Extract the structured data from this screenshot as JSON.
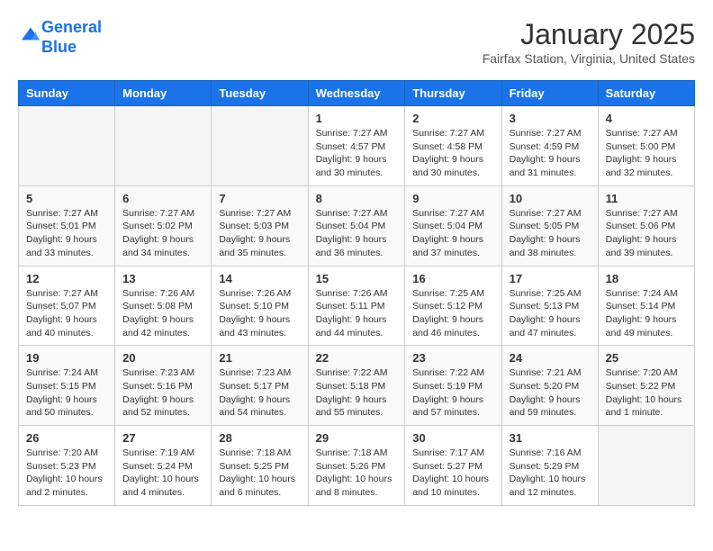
{
  "header": {
    "logo_line1": "General",
    "logo_line2": "Blue",
    "month": "January 2025",
    "location": "Fairfax Station, Virginia, United States"
  },
  "weekdays": [
    "Sunday",
    "Monday",
    "Tuesday",
    "Wednesday",
    "Thursday",
    "Friday",
    "Saturday"
  ],
  "weeks": [
    [
      {
        "day": "",
        "info": ""
      },
      {
        "day": "",
        "info": ""
      },
      {
        "day": "",
        "info": ""
      },
      {
        "day": "1",
        "info": "Sunrise: 7:27 AM\nSunset: 4:57 PM\nDaylight: 9 hours\nand 30 minutes."
      },
      {
        "day": "2",
        "info": "Sunrise: 7:27 AM\nSunset: 4:58 PM\nDaylight: 9 hours\nand 30 minutes."
      },
      {
        "day": "3",
        "info": "Sunrise: 7:27 AM\nSunset: 4:59 PM\nDaylight: 9 hours\nand 31 minutes."
      },
      {
        "day": "4",
        "info": "Sunrise: 7:27 AM\nSunset: 5:00 PM\nDaylight: 9 hours\nand 32 minutes."
      }
    ],
    [
      {
        "day": "5",
        "info": "Sunrise: 7:27 AM\nSunset: 5:01 PM\nDaylight: 9 hours\nand 33 minutes."
      },
      {
        "day": "6",
        "info": "Sunrise: 7:27 AM\nSunset: 5:02 PM\nDaylight: 9 hours\nand 34 minutes."
      },
      {
        "day": "7",
        "info": "Sunrise: 7:27 AM\nSunset: 5:03 PM\nDaylight: 9 hours\nand 35 minutes."
      },
      {
        "day": "8",
        "info": "Sunrise: 7:27 AM\nSunset: 5:04 PM\nDaylight: 9 hours\nand 36 minutes."
      },
      {
        "day": "9",
        "info": "Sunrise: 7:27 AM\nSunset: 5:04 PM\nDaylight: 9 hours\nand 37 minutes."
      },
      {
        "day": "10",
        "info": "Sunrise: 7:27 AM\nSunset: 5:05 PM\nDaylight: 9 hours\nand 38 minutes."
      },
      {
        "day": "11",
        "info": "Sunrise: 7:27 AM\nSunset: 5:06 PM\nDaylight: 9 hours\nand 39 minutes."
      }
    ],
    [
      {
        "day": "12",
        "info": "Sunrise: 7:27 AM\nSunset: 5:07 PM\nDaylight: 9 hours\nand 40 minutes."
      },
      {
        "day": "13",
        "info": "Sunrise: 7:26 AM\nSunset: 5:08 PM\nDaylight: 9 hours\nand 42 minutes."
      },
      {
        "day": "14",
        "info": "Sunrise: 7:26 AM\nSunset: 5:10 PM\nDaylight: 9 hours\nand 43 minutes."
      },
      {
        "day": "15",
        "info": "Sunrise: 7:26 AM\nSunset: 5:11 PM\nDaylight: 9 hours\nand 44 minutes."
      },
      {
        "day": "16",
        "info": "Sunrise: 7:25 AM\nSunset: 5:12 PM\nDaylight: 9 hours\nand 46 minutes."
      },
      {
        "day": "17",
        "info": "Sunrise: 7:25 AM\nSunset: 5:13 PM\nDaylight: 9 hours\nand 47 minutes."
      },
      {
        "day": "18",
        "info": "Sunrise: 7:24 AM\nSunset: 5:14 PM\nDaylight: 9 hours\nand 49 minutes."
      }
    ],
    [
      {
        "day": "19",
        "info": "Sunrise: 7:24 AM\nSunset: 5:15 PM\nDaylight: 9 hours\nand 50 minutes."
      },
      {
        "day": "20",
        "info": "Sunrise: 7:23 AM\nSunset: 5:16 PM\nDaylight: 9 hours\nand 52 minutes."
      },
      {
        "day": "21",
        "info": "Sunrise: 7:23 AM\nSunset: 5:17 PM\nDaylight: 9 hours\nand 54 minutes."
      },
      {
        "day": "22",
        "info": "Sunrise: 7:22 AM\nSunset: 5:18 PM\nDaylight: 9 hours\nand 55 minutes."
      },
      {
        "day": "23",
        "info": "Sunrise: 7:22 AM\nSunset: 5:19 PM\nDaylight: 9 hours\nand 57 minutes."
      },
      {
        "day": "24",
        "info": "Sunrise: 7:21 AM\nSunset: 5:20 PM\nDaylight: 9 hours\nand 59 minutes."
      },
      {
        "day": "25",
        "info": "Sunrise: 7:20 AM\nSunset: 5:22 PM\nDaylight: 10 hours\nand 1 minute."
      }
    ],
    [
      {
        "day": "26",
        "info": "Sunrise: 7:20 AM\nSunset: 5:23 PM\nDaylight: 10 hours\nand 2 minutes."
      },
      {
        "day": "27",
        "info": "Sunrise: 7:19 AM\nSunset: 5:24 PM\nDaylight: 10 hours\nand 4 minutes."
      },
      {
        "day": "28",
        "info": "Sunrise: 7:18 AM\nSunset: 5:25 PM\nDaylight: 10 hours\nand 6 minutes."
      },
      {
        "day": "29",
        "info": "Sunrise: 7:18 AM\nSunset: 5:26 PM\nDaylight: 10 hours\nand 8 minutes."
      },
      {
        "day": "30",
        "info": "Sunrise: 7:17 AM\nSunset: 5:27 PM\nDaylight: 10 hours\nand 10 minutes."
      },
      {
        "day": "31",
        "info": "Sunrise: 7:16 AM\nSunset: 5:29 PM\nDaylight: 10 hours\nand 12 minutes."
      },
      {
        "day": "",
        "info": ""
      }
    ]
  ]
}
